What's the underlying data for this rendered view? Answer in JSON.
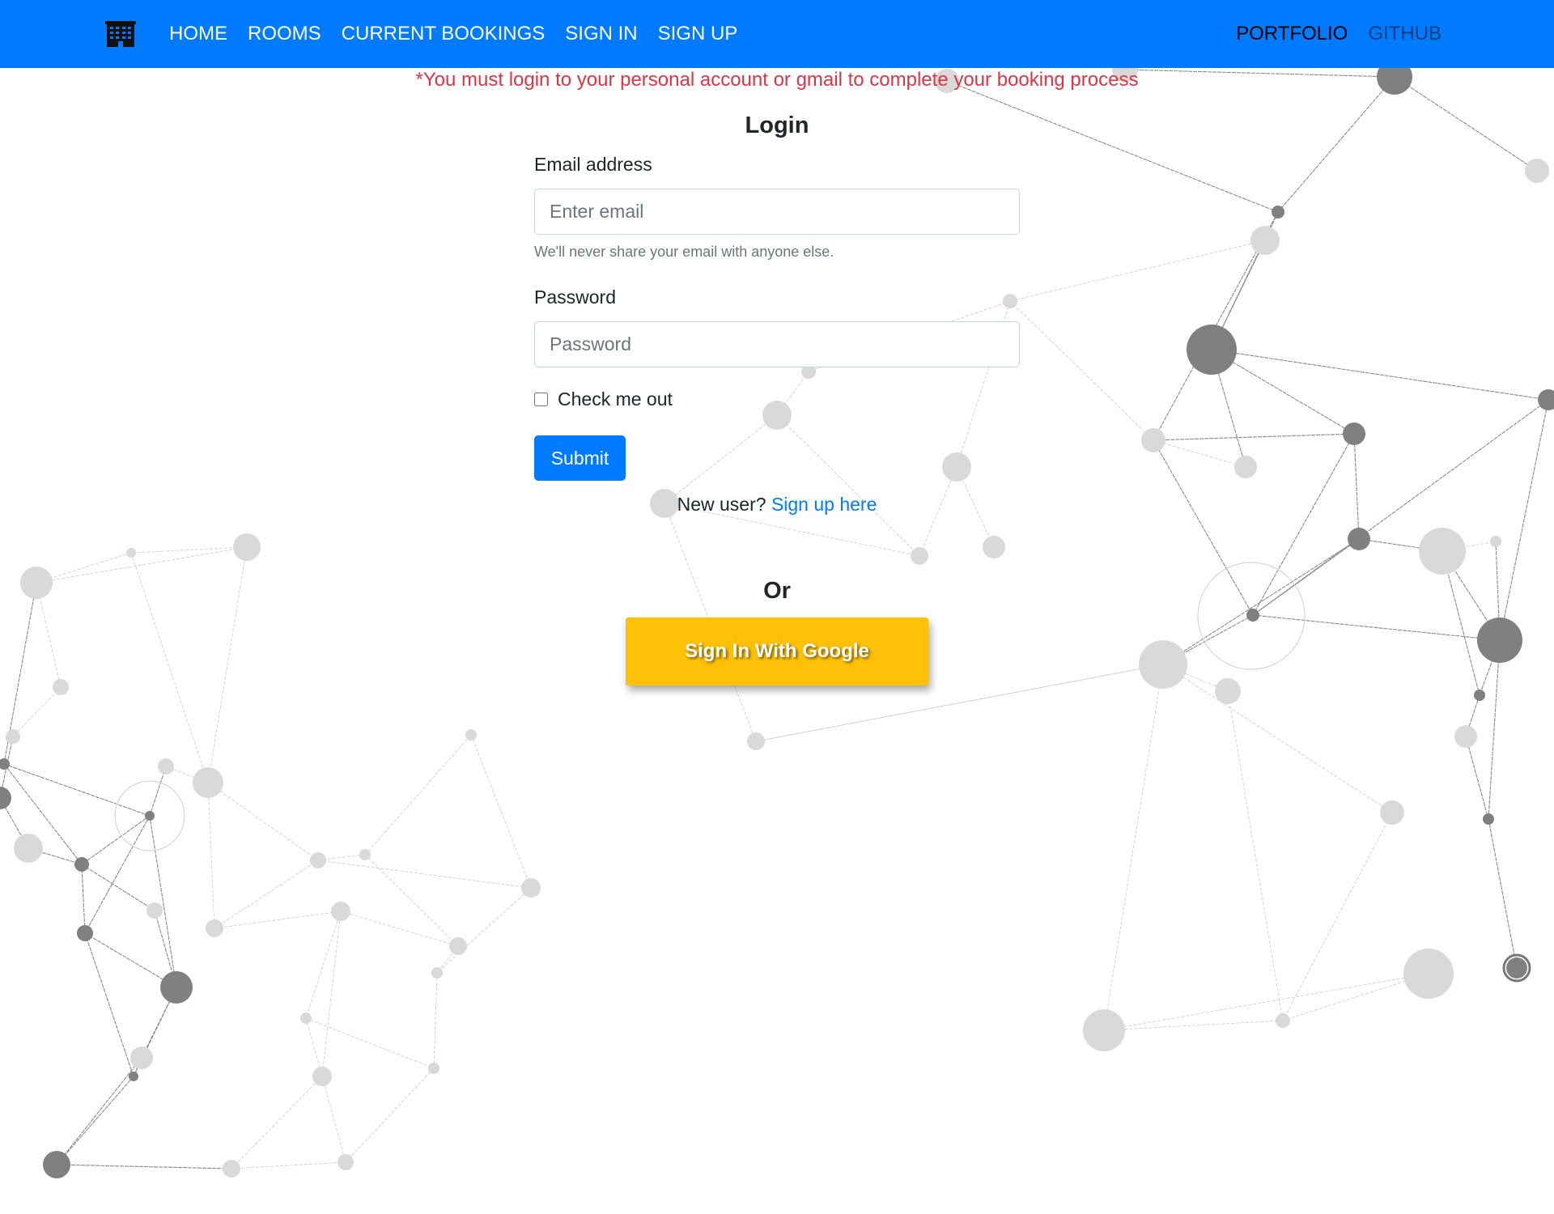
{
  "navbar": {
    "brand_icon": "building-icon",
    "links": [
      "HOME",
      "ROOMS",
      "CURRENT BOOKINGS",
      "SIGN IN",
      "SIGN UP"
    ],
    "right_links": [
      "PORTFOLIO",
      "GITHUB"
    ],
    "color": "#007bff"
  },
  "warning_text": "*You must login to your personal account or gmail to complete your booking process",
  "login": {
    "title": "Login",
    "email_label": "Email address",
    "email_placeholder": "Enter email",
    "email_help": "We'll never share your email with anyone else.",
    "password_label": "Password",
    "password_placeholder": "Password",
    "check_label": "Check me out",
    "submit_label": "Submit",
    "new_user_text": "New user?",
    "signup_link": "Sign up here",
    "or_text": "Or",
    "google_button": "Sign In With Google"
  },
  "colors": {
    "primary": "#007bff",
    "warning": "#dc3545",
    "google": "#ffc107"
  }
}
